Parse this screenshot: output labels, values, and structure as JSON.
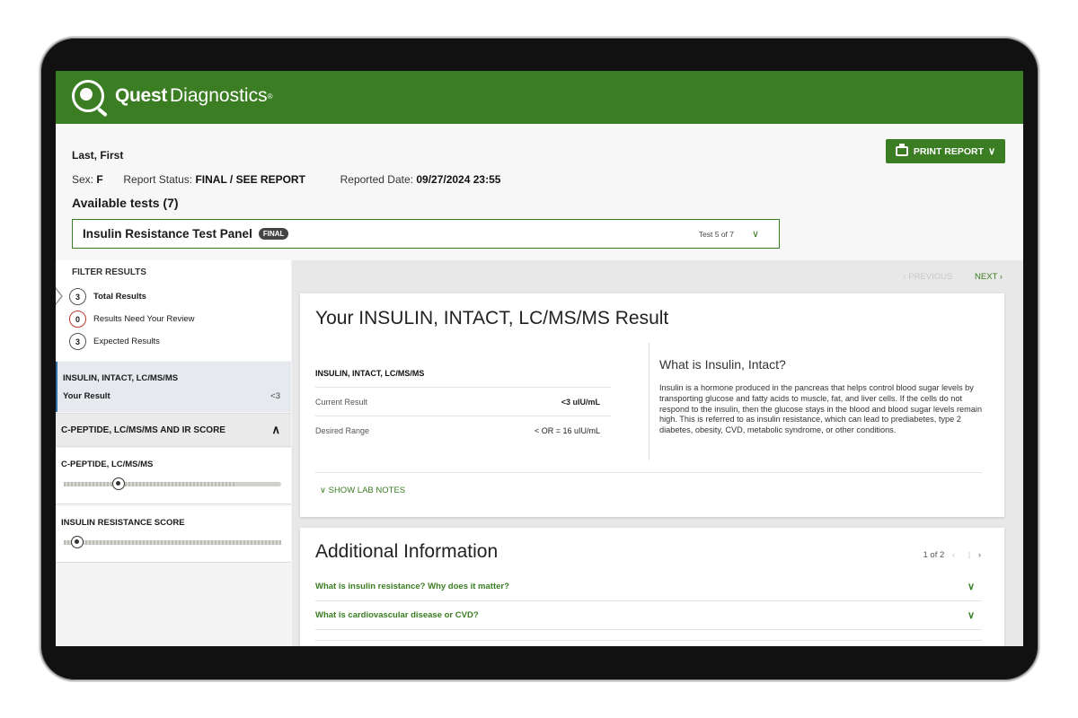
{
  "brand": {
    "name_bold": "Quest",
    "name_regular": "Diagnostics",
    "reg_mark": "®",
    "color": "#3b7d23"
  },
  "patient": {
    "name": "Last, First",
    "sex_label": "Sex:",
    "sex": "F",
    "status_label": "Report Status:",
    "status": "FINAL / SEE REPORT",
    "date_label": "Reported Date:",
    "date": "09/27/2024 23:55"
  },
  "print_button": "PRINT REPORT",
  "available_tests": "Available tests (7)",
  "test_select": {
    "name": "Insulin Resistance Test Panel",
    "badge": "FINAL",
    "count": "Test 5 of 7"
  },
  "filter": {
    "title": "FILTER RESULTS",
    "rows": [
      {
        "count": "3",
        "label": "Total Results"
      },
      {
        "count": "0",
        "label": "Results Need Your Review"
      },
      {
        "count": "3",
        "label": "Expected Results"
      }
    ]
  },
  "sidebar": {
    "active_item": {
      "title": "INSULIN, INTACT, LC/MS/MS",
      "label": "Your Result",
      "value": "<3"
    },
    "group": {
      "title": "C-PEPTIDE, LC/MS/MS AND IR SCORE"
    },
    "subitems": [
      {
        "title": "C-PEPTIDE, LC/MS/MS",
        "level": 0.25
      },
      {
        "title": "INSULIN RESISTANCE SCORE",
        "level": 0.06
      }
    ]
  },
  "pager": {
    "prev": "‹ PREVIOUS",
    "next": "NEXT ›"
  },
  "result_card": {
    "title": "Your INSULIN, INTACT, LC/MS/MS Result",
    "table_head": "INSULIN, INTACT, LC/MS/MS",
    "current_label": "Current Result",
    "current_value": "<3 uIU/mL",
    "range_label": "Desired Range",
    "range_value": "< OR = 16 uIU/mL",
    "info_title": "What is Insulin, Intact?",
    "info_text": "Insulin is a hormone produced in the pancreas that helps control blood sugar levels by transporting glucose and fatty acids to muscle, fat, and liver cells. If the cells do not respond to the insulin, then the glucose stays in the blood and blood sugar levels remain high. This is referred to as insulin resistance, which can lead to prediabetes, type 2 diabetes, obesity, CVD, metabolic syndrome, or other conditions.",
    "lab_notes": "SHOW LAB NOTES"
  },
  "additional": {
    "title": "Additional Information",
    "pager_text": "1 of 2",
    "faqs": [
      "What is insulin resistance? Why does it matter?",
      "What is cardiovascular disease or CVD?"
    ]
  }
}
